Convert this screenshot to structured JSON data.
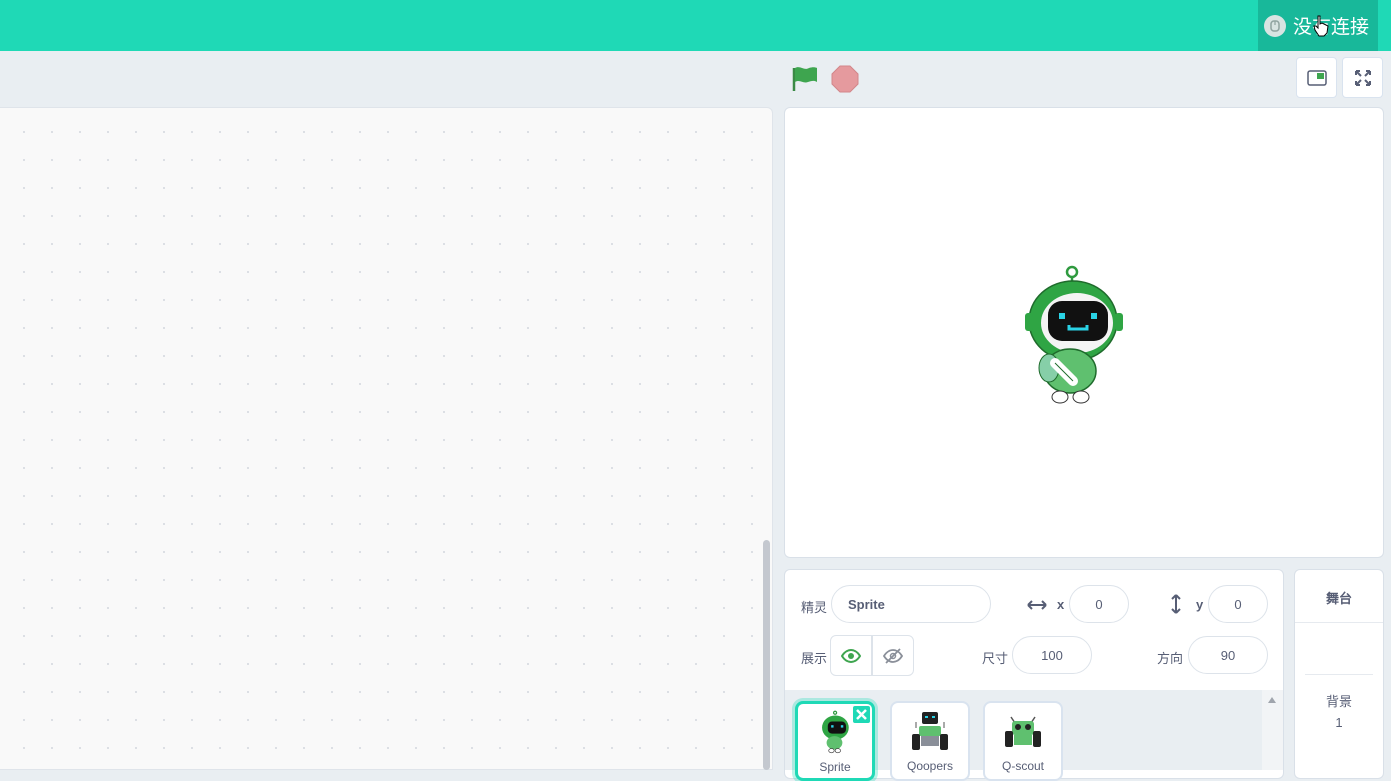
{
  "menubar": {
    "connection_status": "没有连接"
  },
  "controls": {
    "green_flag": "green-flag-icon",
    "stop": "stop-icon"
  },
  "sprite_info": {
    "sprite_label": "精灵",
    "sprite_name": "Sprite",
    "x_label": "x",
    "x_value": "0",
    "y_label": "y",
    "y_value": "0",
    "show_label": "展示",
    "size_label": "尺寸",
    "size_value": "100",
    "direction_label": "方向",
    "direction_value": "90"
  },
  "sprites": [
    {
      "name": "Sprite",
      "selected": true
    },
    {
      "name": "Qoopers",
      "selected": false
    },
    {
      "name": "Q-scout",
      "selected": false
    }
  ],
  "stage_panel": {
    "title": "舞台",
    "backdrop_label": "背景",
    "backdrop_count": "1"
  },
  "colors": {
    "accent": "#1fd9b6",
    "accent_dark": "#18b89a",
    "flag": "#3ea54f",
    "stop": "#e59a9e"
  }
}
